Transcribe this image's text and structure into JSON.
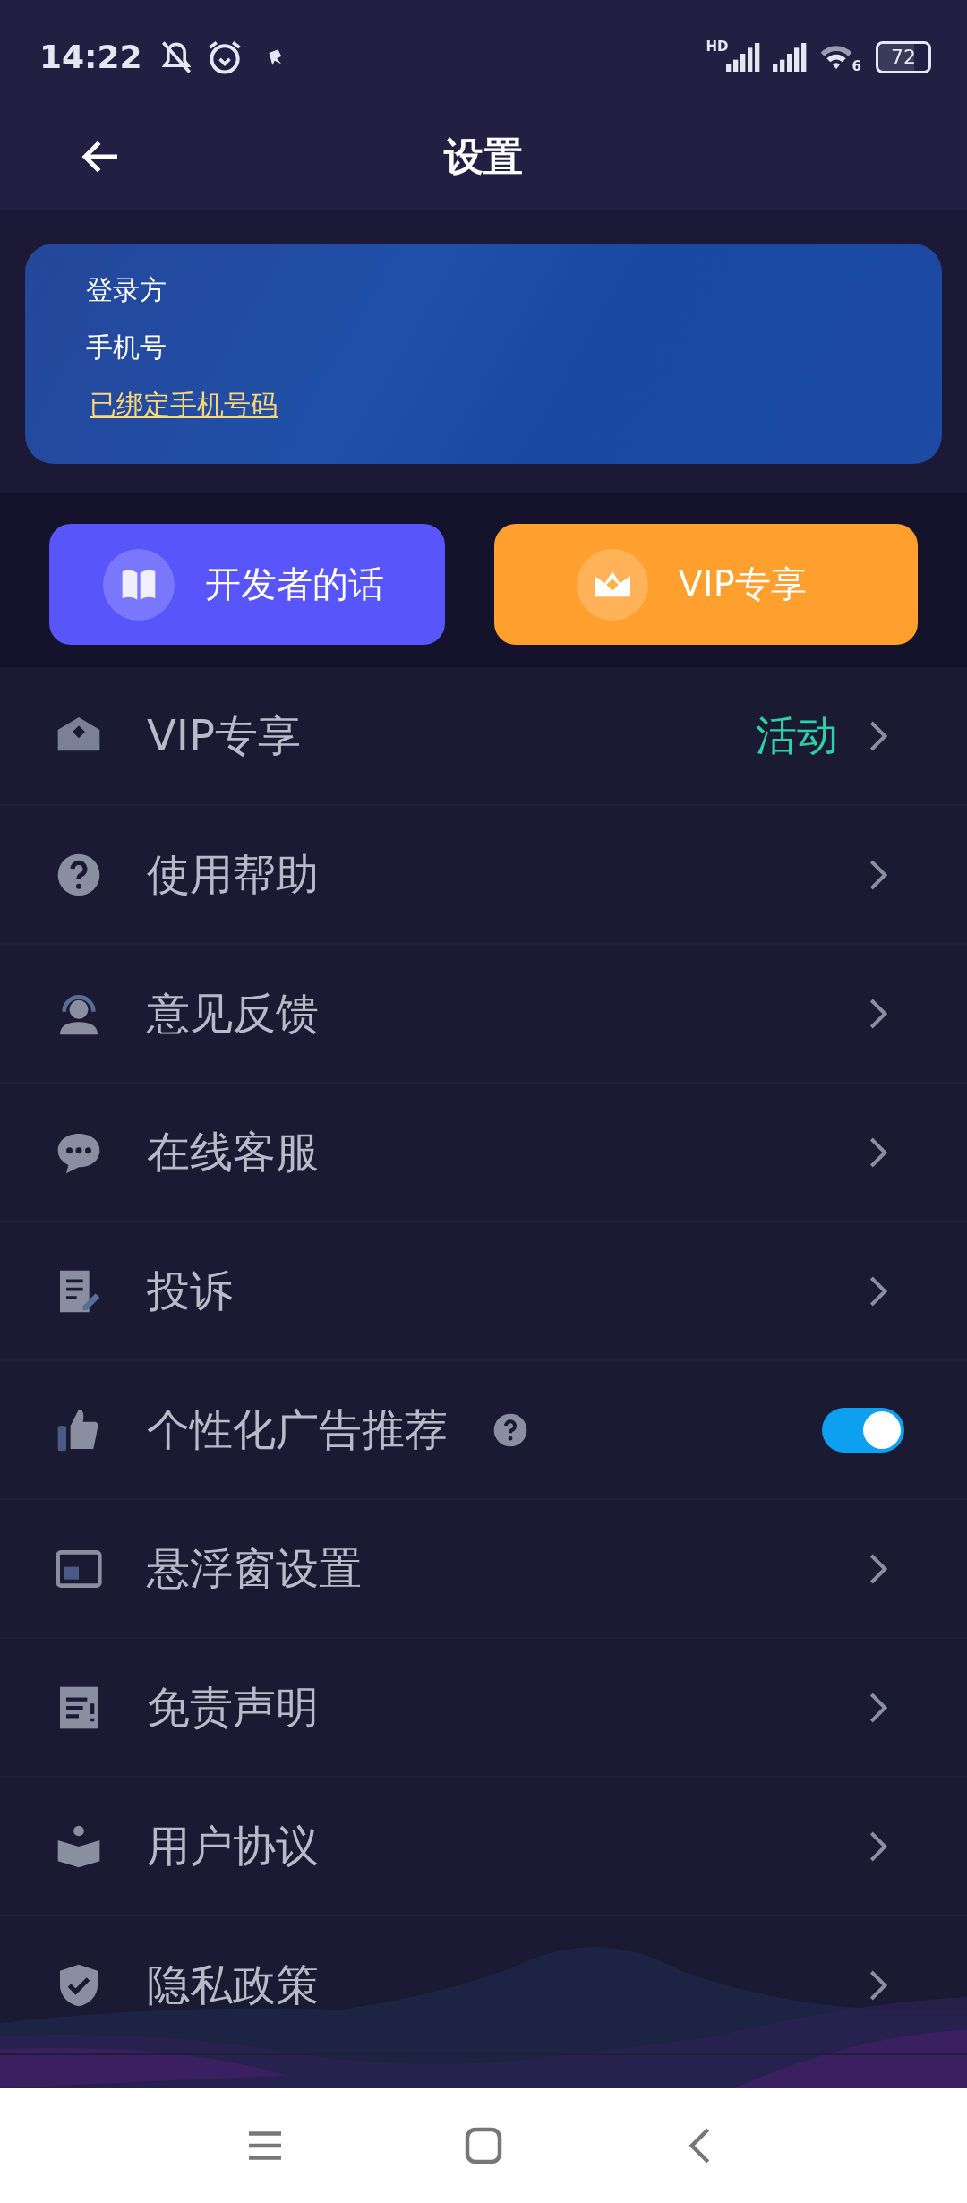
{
  "status_bar": {
    "time": "14:22",
    "network": "HD",
    "wifi": "6",
    "battery": "72"
  },
  "header": {
    "title": "设置"
  },
  "account_card": {
    "login_label": "登录方",
    "phone_label": "手机号",
    "link": "已绑定手机号码"
  },
  "quick_buttons": [
    {
      "label": "开发者的话",
      "kind": "developer"
    },
    {
      "label": "VIP专享",
      "kind": "vip"
    }
  ],
  "rows": [
    {
      "label": "VIP专享",
      "kind": "link",
      "value": "活动"
    },
    {
      "label": "使用帮助",
      "kind": "link"
    },
    {
      "label": "意见反馈",
      "kind": "link"
    },
    {
      "label": "在线客服",
      "kind": "link"
    },
    {
      "label": "投诉",
      "kind": "link"
    },
    {
      "label": "个性化广告推荐",
      "kind": "toggle",
      "on": true
    },
    {
      "label": "悬浮窗设置",
      "kind": "link"
    },
    {
      "label": "免责声明",
      "kind": "link"
    },
    {
      "label": "用户协议",
      "kind": "link"
    },
    {
      "label": "隐私政策",
      "kind": "link"
    }
  ]
}
